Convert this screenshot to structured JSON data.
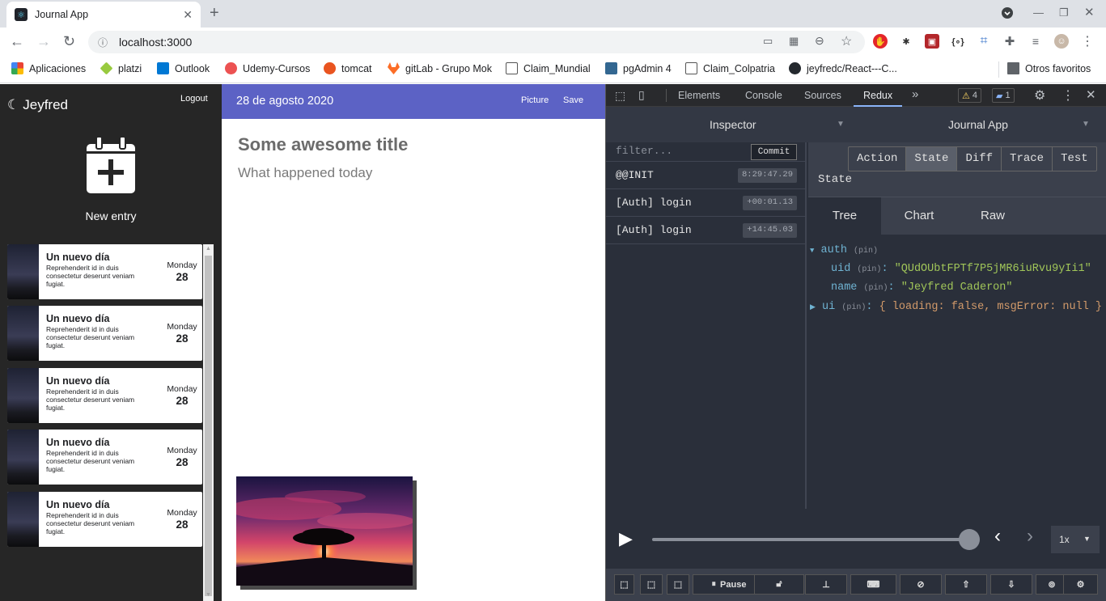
{
  "browser": {
    "tab_title": "Journal App",
    "url": "localhost:3000",
    "bookmarks": [
      {
        "label": "Aplicaciones",
        "color": "#ea4335"
      },
      {
        "label": "platzi",
        "color": "#98ca3f"
      },
      {
        "label": "Outlook",
        "color": "#0078d4"
      },
      {
        "label": "Udemy-Cursos",
        "color": "#a435f0"
      },
      {
        "label": "tomcat",
        "color": "#d9531e"
      },
      {
        "label": "gitLab - Grupo Mok",
        "color": "#fc6d26"
      },
      {
        "label": "Claim_Mundial",
        "color": "#555555"
      },
      {
        "label": "pgAdmin 4",
        "color": "#336791"
      },
      {
        "label": "Claim_Colpatria",
        "color": "#555555"
      },
      {
        "label": "jeyfredc/React---C...",
        "color": "#24292e"
      }
    ],
    "other_favorites": "Otros favoritos"
  },
  "app": {
    "user": "Jeyfred",
    "logout": "Logout",
    "new_entry": "New entry",
    "entries": [
      {
        "title": "Un nuevo día",
        "body": "Reprehenderit id in duis consectetur deserunt veniam fugiat.",
        "day": "Monday",
        "num": "28"
      },
      {
        "title": "Un nuevo día",
        "body": "Reprehenderit id in duis consectetur deserunt veniam fugiat.",
        "day": "Monday",
        "num": "28"
      },
      {
        "title": "Un nuevo día",
        "body": "Reprehenderit id in duis consectetur deserunt veniam fugiat.",
        "day": "Monday",
        "num": "28"
      },
      {
        "title": "Un nuevo día",
        "body": "Reprehenderit id in duis consectetur deserunt veniam fugiat.",
        "day": "Monday",
        "num": "28"
      },
      {
        "title": "Un nuevo día",
        "body": "Reprehenderit id in duis consectetur deserunt veniam fugiat.",
        "day": "Monday",
        "num": "28"
      }
    ],
    "note": {
      "date": "28 de agosto 2020",
      "picture": "Picture",
      "save": "Save",
      "title": "Some awesome title",
      "body": "What happened today"
    }
  },
  "devtools": {
    "tabs": [
      "Elements",
      "Console",
      "Sources",
      "Redux"
    ],
    "active_tab": "Redux",
    "warnings": "4",
    "messages": "1",
    "redux": {
      "monitor": "Inspector",
      "instance": "Journal App",
      "filter_placeholder": "filter...",
      "commit": "Commit",
      "actions": [
        {
          "name": "@@INIT",
          "time": "8:29:47.29"
        },
        {
          "name": "[Auth] login",
          "time": "+00:01.13"
        },
        {
          "name": "[Auth] login",
          "time": "+14:45.03"
        }
      ],
      "inspector_tabs": [
        "Action",
        "State",
        "Diff",
        "Trace",
        "Test"
      ],
      "active_inspector_tab": "State",
      "state_label": "State",
      "view_tabs": [
        "Tree",
        "Chart",
        "Raw"
      ],
      "active_view_tab": "Tree",
      "tree": {
        "auth_key": "auth",
        "pin": "(pin)",
        "uid_key": "uid",
        "uid_value": "\"QUdOUbtFPTf7P5jMR6iuRvu9yIi1\"",
        "name_key": "name",
        "name_value": "\"Jeyfred Caderon\"",
        "ui_key": "ui",
        "ui_value": "{ loading: false, msgError: null }"
      },
      "speed": "1x",
      "pause": "Pause",
      "slider_position": 1.0
    }
  }
}
